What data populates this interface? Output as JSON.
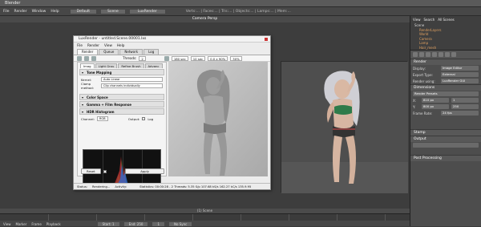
{
  "app": {
    "window_title": "Blender",
    "menus": [
      "File",
      "Render",
      "Window",
      "Help"
    ],
    "screen": "Default",
    "scene": "Scene",
    "engine": "LuxRender",
    "stats": "Verts:... | Faces:... | Tris:... | Objects:... | Lamps:... | Mem:..."
  },
  "viewport": {
    "header": "Camera Persp",
    "footer": "(1) Scene",
    "mode": "Object Mode",
    "global": "Global"
  },
  "outliner": {
    "tabs": [
      "View",
      "Search",
      "All Scenes"
    ],
    "items": [
      "Scene",
      "RenderLayers",
      "World",
      "Camera",
      "Lamp",
      "Lamp",
      "Hair_mesh",
      "BaseMesh"
    ]
  },
  "properties": {
    "rows": [
      {
        "label": "Render",
        "value": ""
      },
      {
        "label": "Display:",
        "value": "Image Editor"
      },
      {
        "label": "Export Type:",
        "value": "External"
      },
      {
        "label": "Render using:",
        "value": "LuxRender GUI"
      },
      {
        "label": "Presets",
        "value": "Render Presets"
      },
      {
        "label": "X:",
        "value": "810 px"
      },
      {
        "label": "Y:",
        "value": "800 px"
      },
      {
        "label": "Start Frame:",
        "value": "1"
      },
      {
        "label": "End Frame:",
        "value": "250"
      },
      {
        "label": "Frame Rate:",
        "value": "24 fps"
      },
      {
        "label": "Stamp",
        "value": ""
      },
      {
        "label": "Output",
        "value": ""
      }
    ],
    "sections": [
      "Dimensions",
      "Stamp",
      "Output",
      "Post Processing"
    ]
  },
  "bottom": {
    "menus": [
      "View",
      "Marker",
      "Frame",
      "Playback"
    ],
    "start_label": "Start: 1",
    "end_label": "End: 250",
    "frame": "1",
    "sync": "No Sync"
  },
  "luxrender": {
    "title": "LuxRender - untitled.Scene.00001.lxs",
    "menus": [
      "File",
      "Render",
      "View",
      "Help"
    ],
    "tabs": [
      "Render",
      "Queue",
      "Network",
      "Log"
    ],
    "threads_label": "Threads:",
    "threads_value": "2",
    "toolbar_fields": [
      "180 sec",
      "10 sec",
      "0.0 x 90%",
      "30%"
    ],
    "subtabs": [
      "Imag",
      "Light Grou",
      "Refine Brush",
      "Advanc"
    ],
    "sections": [
      "Tone Mapping",
      "Color Space",
      "Gamma + Film Response",
      "HDR Histogram"
    ],
    "kernel_label": "Kernel:",
    "kernel_value": "Auto Linear",
    "clamp_label": "Clamp method:",
    "clamp_value": "Clip channels individually",
    "hist_channel_label": "Channel:",
    "hist_channel_value": "RGB",
    "output_label": "Output:",
    "log_label": "Log",
    "reset_btn": "Reset",
    "auto_label": "Auto",
    "apply_btn": "Apply",
    "status_label": "Status:",
    "status_value": "Rendering...",
    "activity_label": "Activity:",
    "statistics": "Statistics: 00:00:28 - 2 Threads: 5.35 S/p 107.68 kS/s 162.27 kC/s 135.9.95"
  }
}
